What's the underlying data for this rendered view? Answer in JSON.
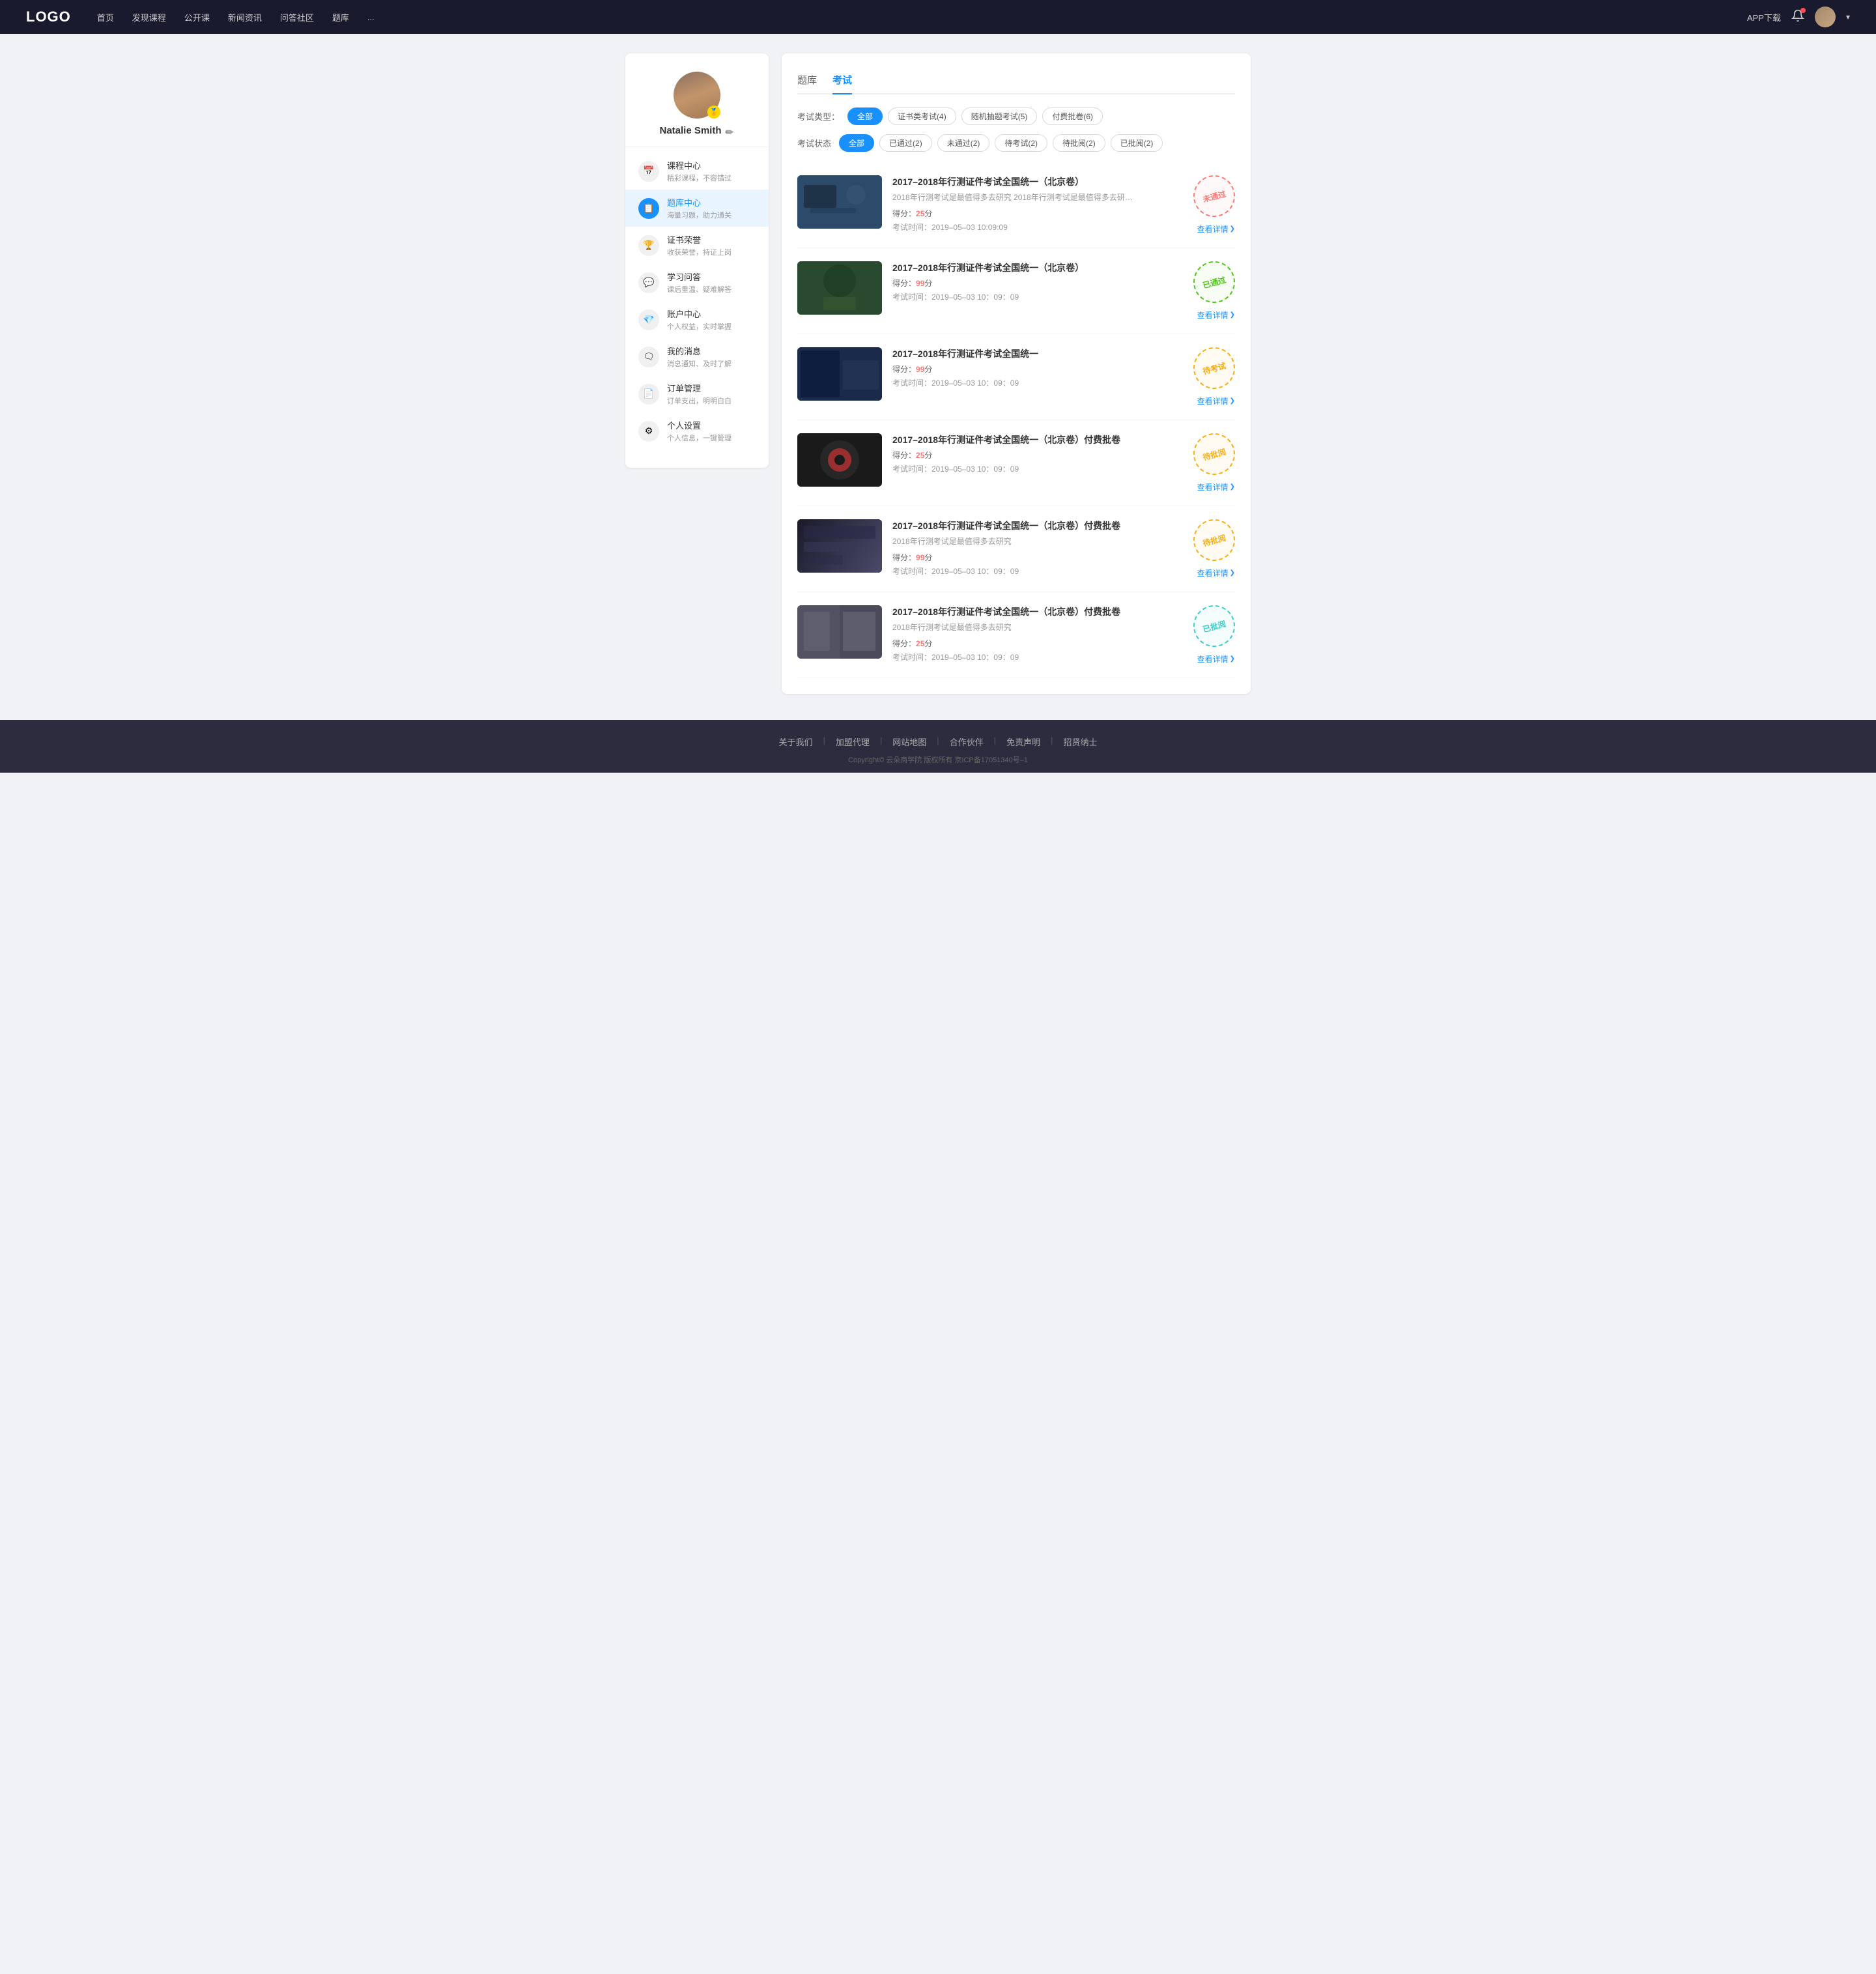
{
  "navbar": {
    "logo": "LOGO",
    "nav_items": [
      "首页",
      "发现课程",
      "公开课",
      "新闻资讯",
      "问答社区",
      "题库",
      "..."
    ],
    "app_download": "APP下载",
    "avatar_label": "用户头像"
  },
  "sidebar": {
    "username": "Natalie Smith",
    "badge": "🏅",
    "edit_icon": "✏",
    "menu_items": [
      {
        "id": "course",
        "icon": "📅",
        "title": "课程中心",
        "subtitle": "精彩课程，不容错过",
        "active": false
      },
      {
        "id": "question",
        "icon": "📋",
        "title": "题库中心",
        "subtitle": "海量习题，助力通关",
        "active": true
      },
      {
        "id": "certificate",
        "icon": "🏆",
        "title": "证书荣誉",
        "subtitle": "收获荣誉，持证上岗",
        "active": false
      },
      {
        "id": "qa",
        "icon": "💬",
        "title": "学习问答",
        "subtitle": "课后重温、疑难解答",
        "active": false
      },
      {
        "id": "account",
        "icon": "💎",
        "title": "账户中心",
        "subtitle": "个人权益，实时掌握",
        "active": false
      },
      {
        "id": "message",
        "icon": "🗨",
        "title": "我的消息",
        "subtitle": "消息通知、及时了解",
        "active": false
      },
      {
        "id": "order",
        "icon": "📄",
        "title": "订单管理",
        "subtitle": "订单支出，明明白白",
        "active": false
      },
      {
        "id": "settings",
        "icon": "⚙",
        "title": "个人设置",
        "subtitle": "个人信息，一键管理",
        "active": false
      }
    ]
  },
  "content": {
    "top_tabs": [
      {
        "id": "question-bank",
        "label": "题库",
        "active": false
      },
      {
        "id": "exam",
        "label": "考试",
        "active": true
      }
    ],
    "filter_type": {
      "label": "考试类型：",
      "options": [
        {
          "id": "all",
          "label": "全部",
          "active": true
        },
        {
          "id": "cert",
          "label": "证书类考试(4)",
          "active": false
        },
        {
          "id": "random",
          "label": "随机抽题考试(5)",
          "active": false
        },
        {
          "id": "paid",
          "label": "付费批卷(6)",
          "active": false
        }
      ]
    },
    "filter_status": {
      "label": "考试状态",
      "options": [
        {
          "id": "all",
          "label": "全部",
          "active": true
        },
        {
          "id": "passed",
          "label": "已通过(2)",
          "active": false
        },
        {
          "id": "failed",
          "label": "未通过(2)",
          "active": false
        },
        {
          "id": "pending",
          "label": "待考试(2)",
          "active": false
        },
        {
          "id": "pending-review",
          "label": "待批阅(2)",
          "active": false
        },
        {
          "id": "reviewed",
          "label": "已批阅(2)",
          "active": false
        }
      ]
    },
    "exams": [
      {
        "id": 1,
        "title": "2017–2018年行测证件考试全国统一（北京卷）",
        "desc": "2018年行测考试是最值得多去研究 2018年行测考试是最值得多去研究 2018年行...",
        "score": "25",
        "time": "2019–05–03  10:09:09",
        "stamp_type": "fail",
        "stamp_text": "未通过",
        "view_text": "查看详情",
        "thumb_class": "thumb-1"
      },
      {
        "id": 2,
        "title": "2017–2018年行测证件考试全国统一（北京卷）",
        "desc": "",
        "score": "99",
        "time": "2019–05–03  10：09：09",
        "stamp_type": "pass",
        "stamp_text": "已通过",
        "view_text": "查看详情",
        "thumb_class": "thumb-2"
      },
      {
        "id": 3,
        "title": "2017–2018年行测证件考试全国统一",
        "desc": "",
        "score": "99",
        "time": "2019–05–03  10：09：09",
        "stamp_type": "pending",
        "stamp_text": "待考试",
        "view_text": "查看详情",
        "thumb_class": "thumb-3"
      },
      {
        "id": 4,
        "title": "2017–2018年行测证件考试全国统一（北京卷）付费批卷",
        "desc": "",
        "score": "25",
        "time": "2019–05–03  10：09：09",
        "stamp_type": "pending",
        "stamp_text": "待批阅",
        "view_text": "查看详情",
        "thumb_class": "thumb-4"
      },
      {
        "id": 5,
        "title": "2017–2018年行测证件考试全国统一（北京卷）付费批卷",
        "desc": "2018年行测考试是最值得多去研究",
        "score": "99",
        "time": "2019–05–03  10：09：09",
        "stamp_type": "pending",
        "stamp_text": "待批阅",
        "view_text": "查看详情",
        "thumb_class": "thumb-5"
      },
      {
        "id": 6,
        "title": "2017–2018年行测证件考试全国统一（北京卷）付费批卷",
        "desc": "2018年行测考试是最值得多去研究",
        "score": "25",
        "time": "2019–05–03  10：09：09",
        "stamp_type": "reviewed",
        "stamp_text": "已批阅",
        "view_text": "查看详情",
        "thumb_class": "thumb-6"
      }
    ]
  },
  "footer": {
    "links": [
      "关于我们",
      "加盟代理",
      "网站地图",
      "合作伙伴",
      "免责声明",
      "招贤纳士"
    ],
    "copyright": "Copyright© 云朵商学院  版权所有    京ICP备17051340号–1"
  }
}
